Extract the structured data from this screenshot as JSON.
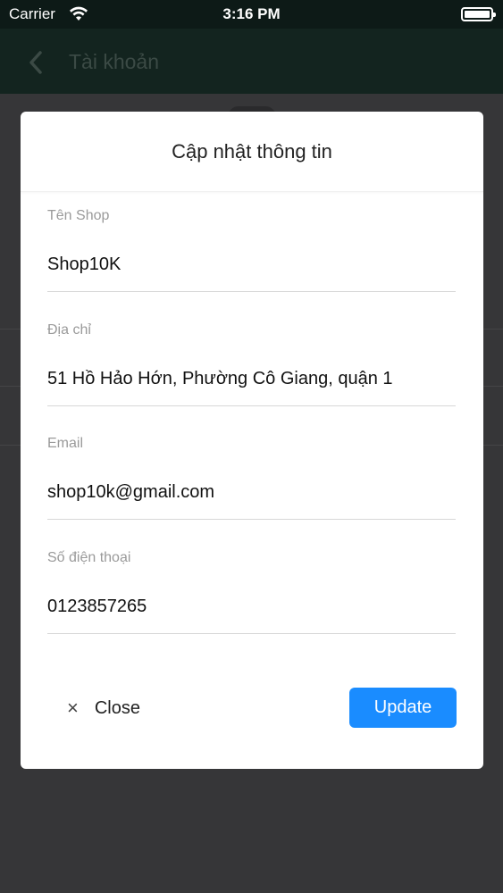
{
  "status_bar": {
    "carrier": "Carrier",
    "time": "3:16 PM"
  },
  "nav": {
    "title": "Tài khoản"
  },
  "modal": {
    "title": "Cập nhật thông tin",
    "fields": [
      {
        "label": "Tên Shop",
        "value": "Shop10K"
      },
      {
        "label": "Địa chỉ",
        "value": "51 Hồ Hảo Hớn, Phường Cô Giang, quận 1"
      },
      {
        "label": "Email",
        "value": "shop10k@gmail.com"
      },
      {
        "label": "Số điện thoại",
        "value": "0123857265"
      }
    ],
    "close_label": "Close",
    "close_icon": "×",
    "update_label": "Update"
  },
  "colors": {
    "accent": "#1a8cff",
    "overlay": "#363638",
    "nav": "#13241f"
  }
}
